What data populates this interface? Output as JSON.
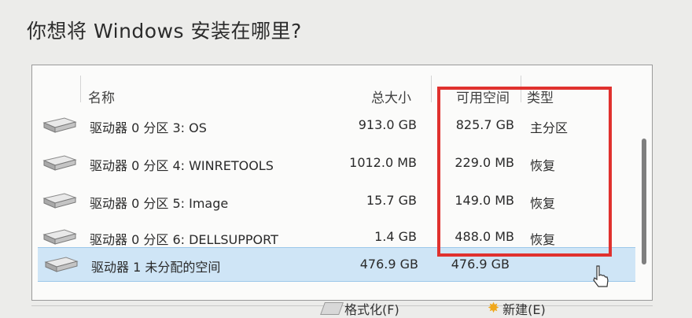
{
  "title": "你想将 Windows 安装在哪里?",
  "columns": {
    "name": "名称",
    "total": "总大小",
    "free": "可用空间",
    "type": "类型"
  },
  "partitions": [
    {
      "name": "驱动器 0 分区 3: OS",
      "total": "913.0 GB",
      "free": "825.7 GB",
      "type": "主分区"
    },
    {
      "name": "驱动器 0 分区 4: WINRETOOLS",
      "total": "1012.0 MB",
      "free": "229.0 MB",
      "type": "恢复"
    },
    {
      "name": "驱动器 0 分区 5: Image",
      "total": "15.7 GB",
      "free": "149.0 MB",
      "type": "恢复"
    },
    {
      "name": "驱动器 0 分区 6: DELLSUPPORT",
      "total": "1.4 GB",
      "free": "488.0 MB",
      "type": "恢复"
    },
    {
      "name": "驱动器 1 未分配的空间",
      "total": "476.9 GB",
      "free": "476.9 GB",
      "type": ""
    }
  ],
  "selected_index": 4,
  "actions": {
    "format_label": "格式化(F)",
    "new_label": "新建(E)"
  },
  "colors": {
    "highlight_box": "#e0312e",
    "selection": "#cfe5f6"
  }
}
